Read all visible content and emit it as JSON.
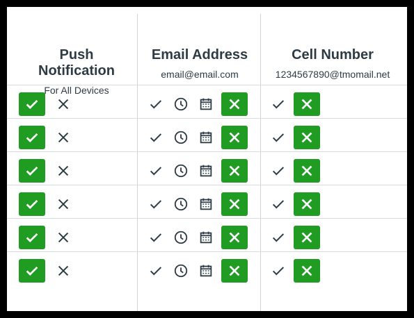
{
  "columns": [
    {
      "title": "Push Notification",
      "subtitle": "For All Devices"
    },
    {
      "title": "Email Address",
      "subtitle": "email@email.com"
    },
    {
      "title": "Cell Number",
      "subtitle": "1234567890@tmomail.net"
    }
  ],
  "rows": [
    {
      "push": "on",
      "email": "off",
      "cell": "off"
    },
    {
      "push": "on",
      "email": "off",
      "cell": "off"
    },
    {
      "push": "on",
      "email": "off",
      "cell": "off"
    },
    {
      "push": "on",
      "email": "off",
      "cell": "off"
    },
    {
      "push": "on",
      "email": "off",
      "cell": "off"
    },
    {
      "push": "on",
      "email": "off",
      "cell": "off"
    }
  ],
  "colors": {
    "green": "#1f9c21",
    "text": "#2d3b45"
  },
  "icons": [
    "checkmark-icon",
    "close-icon",
    "clock-icon",
    "calendar-icon"
  ]
}
